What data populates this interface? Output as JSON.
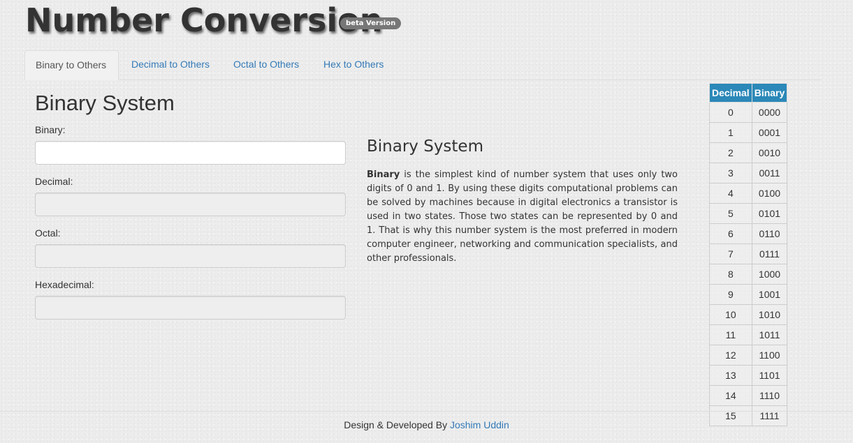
{
  "header": {
    "title": "Number Conversion",
    "badge": "beta Version"
  },
  "tabs": [
    {
      "label": "Binary to Others",
      "active": true
    },
    {
      "label": "Decimal to Others",
      "active": false
    },
    {
      "label": "Octal to Others",
      "active": false
    },
    {
      "label": "Hex to Others",
      "active": false
    }
  ],
  "form": {
    "heading": "Binary System",
    "fields": [
      {
        "label": "Binary:",
        "value": "",
        "readonly": false
      },
      {
        "label": "Decimal:",
        "value": "",
        "readonly": true
      },
      {
        "label": "Octal:",
        "value": "",
        "readonly": true
      },
      {
        "label": "Hexadecimal:",
        "value": "",
        "readonly": true
      }
    ]
  },
  "info": {
    "heading": "Binary System",
    "bold_term": "Binary",
    "text": " is the simplest kind of number system that uses only two digits of 0 and 1. By using these digits computational problems can be solved by machines because in digital electronics a transistor is used in two states. Those two states can be represented by 0 and 1. That is why this number system is the most preferred in modern computer engineer, networking and communication specialists, and other professionals."
  },
  "table": {
    "headers": [
      "Decimal",
      "Binary"
    ],
    "rows": [
      [
        "0",
        "0000"
      ],
      [
        "1",
        "0001"
      ],
      [
        "2",
        "0010"
      ],
      [
        "3",
        "0011"
      ],
      [
        "4",
        "0100"
      ],
      [
        "5",
        "0101"
      ],
      [
        "6",
        "0110"
      ],
      [
        "7",
        "0111"
      ],
      [
        "8",
        "1000"
      ],
      [
        "9",
        "1001"
      ],
      [
        "10",
        "1010"
      ],
      [
        "11",
        "1011"
      ],
      [
        "12",
        "1100"
      ],
      [
        "13",
        "1101"
      ],
      [
        "14",
        "1110"
      ],
      [
        "15",
        "1111"
      ]
    ]
  },
  "footer": {
    "text": "Design & Developed By ",
    "author": "Joshim Uddin"
  },
  "colors": {
    "accent": "#337ab7",
    "table_header": "#2b88b8",
    "badge": "#777777"
  }
}
